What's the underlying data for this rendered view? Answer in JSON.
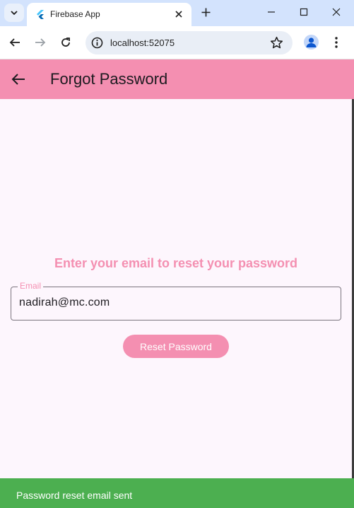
{
  "browser": {
    "tab_title": "Firebase App",
    "url": "localhost:52075"
  },
  "appbar": {
    "title": "Forgot Password"
  },
  "form": {
    "headline": "Enter your email to reset your password",
    "email_label": "Email",
    "email_value": "nadirah@mc.com",
    "submit_label": "Reset Password"
  },
  "snackbar": {
    "message": "Password reset email sent"
  },
  "colors": {
    "primary": "#f48fb1",
    "background": "#fdf6fd",
    "snackbar": "#4caf50",
    "tabstrip": "#d3e3fd"
  },
  "icons": {
    "back": "arrow-left-icon",
    "tab_favicon": "flutter-icon",
    "info": "info-icon",
    "star": "star-icon",
    "profile": "profile-icon"
  }
}
